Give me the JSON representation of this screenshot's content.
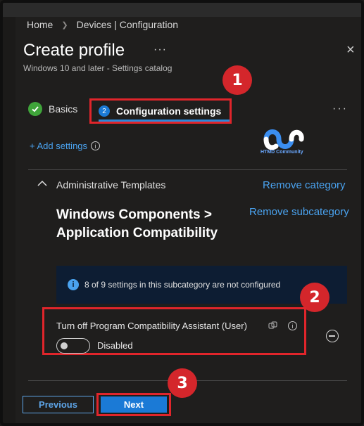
{
  "breadcrumb": {
    "home": "Home",
    "current": "Devices | Configuration"
  },
  "header": {
    "title": "Create profile",
    "more": "···",
    "close": "×",
    "subtitle": "Windows 10 and later - Settings catalog"
  },
  "steps": [
    {
      "label": "Basics",
      "status": "completed"
    },
    {
      "number": "2",
      "label": "Configuration settings",
      "status": "active"
    }
  ],
  "step_overflow": "···",
  "annotations": [
    "1",
    "2",
    "3"
  ],
  "logo": {
    "text": "HTMD Community"
  },
  "add_settings": {
    "label": "+ Add settings",
    "info": "i"
  },
  "category": {
    "label": "Administrative Templates",
    "remove_category": "Remove category",
    "subcategory_title": "Windows Components > Application Compatibility",
    "remove_subcategory": "Remove subcategory"
  },
  "info_bar": {
    "icon": "i",
    "text": "8 of 9 settings in this subcategory are not configured"
  },
  "setting": {
    "label": "Turn off Program Compatibility Assistant (User)",
    "info": "i",
    "toggle_state": "off",
    "toggle_label": "Disabled"
  },
  "footer": {
    "previous": "Previous",
    "next": "Next"
  },
  "colors": {
    "accent": "#1b7ad6",
    "link": "#4aa3f0",
    "highlight": "#e0252b",
    "success": "#3fa43a"
  }
}
